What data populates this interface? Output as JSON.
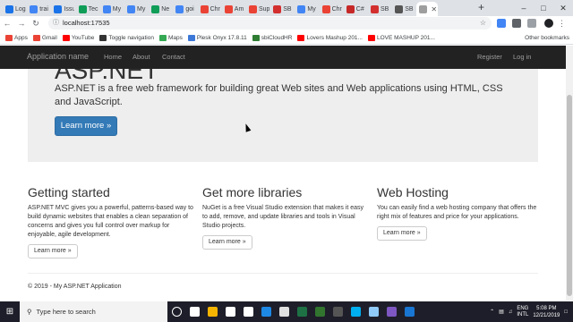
{
  "browser": {
    "tabs": [
      {
        "label": "Log",
        "color": "#1a73e8"
      },
      {
        "label": "trai",
        "color": "#4285f4"
      },
      {
        "label": "Issu",
        "color": "#1a73e8"
      },
      {
        "label": "Tec",
        "color": "#0f9d58"
      },
      {
        "label": "My",
        "color": "#4285f4"
      },
      {
        "label": "My",
        "color": "#4285f4"
      },
      {
        "label": "Ne",
        "color": "#0f9d58"
      },
      {
        "label": "goi",
        "color": "#4285f4"
      },
      {
        "label": "Chr",
        "color": "#ea4335"
      },
      {
        "label": "Am",
        "color": "#ea4335"
      },
      {
        "label": "Sup",
        "color": "#ea4335"
      },
      {
        "label": "SB",
        "color": "#d32f2f"
      },
      {
        "label": "My",
        "color": "#4285f4"
      },
      {
        "label": "Chr",
        "color": "#ea4335"
      },
      {
        "label": "C#",
        "color": "#c62828"
      },
      {
        "label": "SB",
        "color": "#d32f2f"
      },
      {
        "label": "SB",
        "color": "#555555"
      },
      {
        "label": "",
        "color": "#9e9e9e",
        "active": true
      }
    ],
    "new_tab": "+",
    "url": "localhost:17535",
    "bookmarks": [
      {
        "label": "Apps",
        "color": "#ea4335"
      },
      {
        "label": "Gmail",
        "color": "#ea4335"
      },
      {
        "label": "YouTube",
        "color": "#ff0000"
      },
      {
        "label": "Toggle navigation",
        "color": "#333333"
      },
      {
        "label": "Maps",
        "color": "#34a853"
      },
      {
        "label": "Plesk Onyx 17.8.11",
        "color": "#3c78d8"
      },
      {
        "label": "sbiCloudHR",
        "color": "#2e7d32"
      },
      {
        "label": "Lovers Mashup 201...",
        "color": "#ff0000"
      },
      {
        "label": "LOVE MASHUP 201...",
        "color": "#ff0000"
      }
    ],
    "other_bookmarks": "Other bookmarks"
  },
  "site": {
    "brand": "Application name",
    "nav": [
      "Home",
      "About",
      "Contact"
    ],
    "nav_right": [
      "Register",
      "Log in"
    ],
    "jumbotron": {
      "title": "ASP.NET",
      "lead": "ASP.NET is a free web framework for building great Web sites and Web applications using HTML, CSS and JavaScript.",
      "button": "Learn more »"
    },
    "columns": [
      {
        "title": "Getting started",
        "text": "ASP.NET MVC gives you a powerful, patterns-based way to build dynamic websites that enables a clean separation of concerns and gives you full control over markup for enjoyable, agile development.",
        "button": "Learn more »"
      },
      {
        "title": "Get more libraries",
        "text": "NuGet is a free Visual Studio extension that makes it easy to add, remove, and update libraries and tools in Visual Studio projects.",
        "button": "Learn more »"
      },
      {
        "title": "Web Hosting",
        "text": "You can easily find a web hosting company that offers the right mix of features and price for your applications.",
        "button": "Learn more »"
      }
    ],
    "footer": "© 2019 - My ASP.NET Application"
  },
  "taskbar": {
    "search_placeholder": "Type here to search",
    "apps": [
      {
        "name": "cortana",
        "color": "#ffffff"
      },
      {
        "name": "task-view",
        "color": "#ffffff"
      },
      {
        "name": "file-explorer",
        "color": "#f4b400"
      },
      {
        "name": "store",
        "color": "#ffffff"
      },
      {
        "name": "mail",
        "color": "#ffffff"
      },
      {
        "name": "edge",
        "color": "#1e88e5"
      },
      {
        "name": "chrome",
        "color": "#e0e0e0"
      },
      {
        "name": "excel",
        "color": "#1e7145"
      },
      {
        "name": "project",
        "color": "#31752f"
      },
      {
        "name": "calculator",
        "color": "#555555"
      },
      {
        "name": "skype",
        "color": "#00aff0"
      },
      {
        "name": "tool",
        "color": "#90caf9"
      },
      {
        "name": "visual-studio",
        "color": "#7e57c2"
      },
      {
        "name": "vscode",
        "color": "#1976d2"
      }
    ],
    "lang": "ENG",
    "region": "INTL",
    "time": "5:08 PM",
    "date": "12/21/2019"
  }
}
